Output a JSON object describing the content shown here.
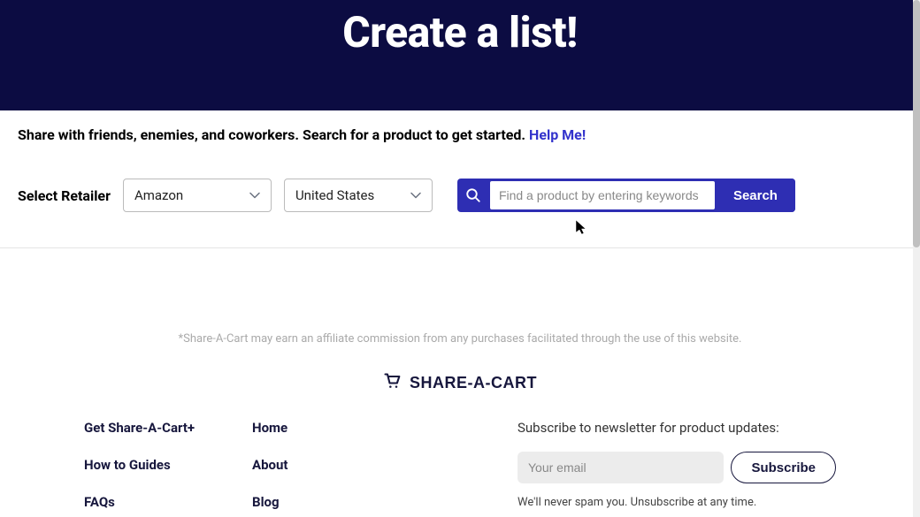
{
  "hero": {
    "title": "Create a list!"
  },
  "instructions": {
    "text": "Share with friends, enemies, and coworkers. Search for a product to get started. ",
    "help_link": "Help Me!"
  },
  "search": {
    "select_label": "Select Retailer",
    "retailer_value": "Amazon",
    "country_value": "United States",
    "placeholder": "Find a product by entering keywords",
    "button": "Search"
  },
  "disclaimer": "*Share-A-Cart may earn an affiliate commission from any purchases facilitated through the use of this website.",
  "brand": {
    "name": "SHARE-A-CART"
  },
  "footer": {
    "col1": [
      "Get Share-A-Cart+",
      "How to Guides",
      "FAQs"
    ],
    "col2": [
      "Home",
      "About",
      "Blog"
    ]
  },
  "newsletter": {
    "title": "Subscribe to newsletter for product updates:",
    "placeholder": "Your email",
    "button": "Subscribe",
    "note": "We'll never spam you. Unsubscribe at any time."
  }
}
